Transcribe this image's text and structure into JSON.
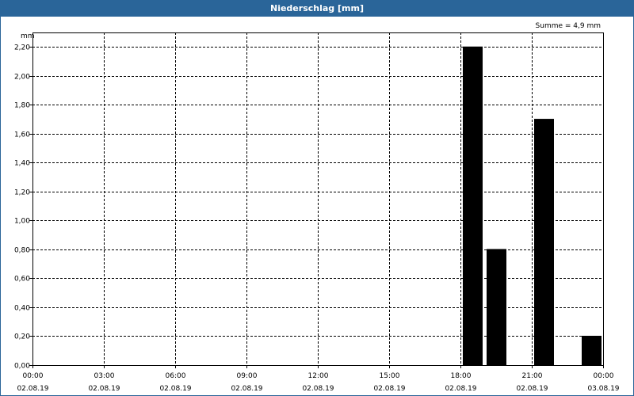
{
  "window": {
    "title": "Niederschlag [mm]"
  },
  "chart_data": {
    "type": "bar",
    "title": "Niederschlag [mm]",
    "ylabel": "mm",
    "xlabel": "",
    "summary": "Summe = 4,9 mm",
    "ylim": [
      0,
      2.3
    ],
    "y_ticks": [
      "0,00",
      "0,20",
      "0,40",
      "0,60",
      "0,80",
      "1,00",
      "1,20",
      "1,40",
      "1,60",
      "1,80",
      "2,00",
      "2,20"
    ],
    "y_tick_values": [
      0,
      0.2,
      0.4,
      0.6,
      0.8,
      1.0,
      1.2,
      1.4,
      1.6,
      1.8,
      2.0,
      2.2
    ],
    "x_ticks": [
      {
        "time": "00:00",
        "date": "02.08.19"
      },
      {
        "time": "03:00",
        "date": "02.08.19"
      },
      {
        "time": "06:00",
        "date": "02.08.19"
      },
      {
        "time": "09:00",
        "date": "02.08.19"
      },
      {
        "time": "12:00",
        "date": "02.08.19"
      },
      {
        "time": "15:00",
        "date": "02.08.19"
      },
      {
        "time": "18:00",
        "date": "02.08.19"
      },
      {
        "time": "21:00",
        "date": "02.08.19"
      },
      {
        "time": "00:00",
        "date": "03.08.19"
      }
    ],
    "x_range": [
      "02.08.19 00:00",
      "03.08.19 00:00"
    ],
    "bars": [
      {
        "start": "02.08.19 18:00",
        "end": "02.08.19 19:00",
        "value": 2.2
      },
      {
        "start": "02.08.19 19:00",
        "end": "02.08.19 20:00",
        "value": 0.8
      },
      {
        "start": "02.08.19 21:00",
        "end": "02.08.19 22:00",
        "value": 1.7
      },
      {
        "start": "02.08.19 23:00",
        "end": "03.08.19 00:00",
        "value": 0.2
      }
    ],
    "bar_color": "#000000",
    "grid": true
  }
}
